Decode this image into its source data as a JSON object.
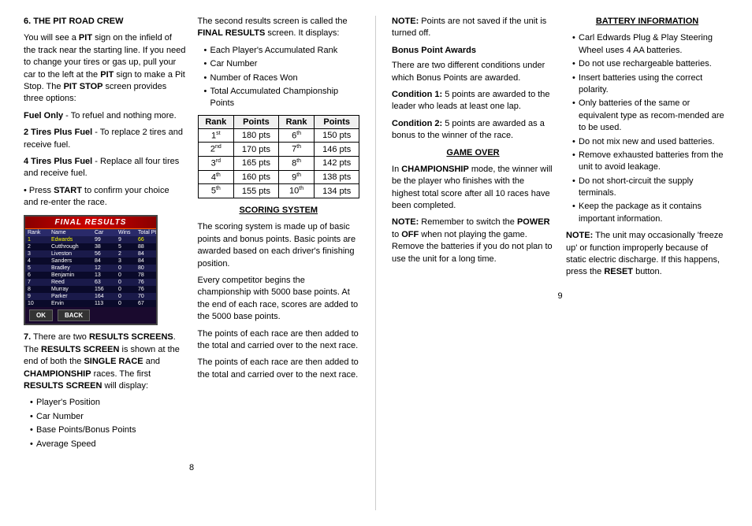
{
  "page_left": {
    "page_number": "8",
    "col1": {
      "section6_heading": "6. THE PIT ROAD CREW",
      "section6_para1": "You will see a ",
      "section6_pit": "PIT",
      "section6_para1b": " sign on the infield of the track near the starting line. If you need to change your tires or gas up, pull your car to the left at the ",
      "section6_pit2": "PIT",
      "section6_para1c": " sign to make a Pit Stop. The ",
      "section6_pitstop": "PIT STOP",
      "section6_para1d": " screen provides three options:",
      "fuel_only_label": "Fuel Only",
      "fuel_only_text": " - To refuel and nothing more.",
      "tires2_label": "2 Tires Plus Fuel",
      "tires2_text": " - To replace 2 tires and receive fuel.",
      "tires4_label": "4 Tires Plus Fuel",
      "tires4_text": " - Replace all four tires and receive fuel.",
      "press_start": "START",
      "press_text": " to confirm your choice and re-enter the race.",
      "final_results_title": "FINAL RESULTS",
      "fr_table_headers": [
        "Rank",
        "Name",
        "Car",
        "Wins",
        "Total Pts"
      ],
      "fr_rows": [
        [
          "1",
          "Edwards",
          "99",
          "9",
          "66"
        ],
        [
          "2",
          "Cutthrough",
          "38",
          "5",
          "88"
        ],
        [
          "3",
          "Liveston",
          "56",
          "2",
          "84"
        ],
        [
          "4",
          "Sanders",
          "84",
          "3",
          "84"
        ],
        [
          "5",
          "Bradley",
          "12",
          "0",
          "80"
        ],
        [
          "6",
          "Benjamin",
          "13",
          "0",
          "78"
        ],
        [
          "7",
          "Reed",
          "63",
          "0",
          "76"
        ],
        [
          "8",
          "Murray",
          "156",
          "0",
          "76"
        ],
        [
          "9",
          "Parker",
          "164",
          "0",
          "70"
        ],
        [
          "10",
          "Ervin",
          "113",
          "0",
          "67"
        ]
      ],
      "fr_ok": "OK",
      "fr_back": "BACK",
      "section7_text1": "7. There are two ",
      "section7_results": "RESULTS",
      "section7_text2": " SCREENS. The ",
      "section7_results2": "RESULTS",
      "section7_text3": " SCREEN is shown at the end of both the ",
      "section7_single": "SINGLE RACE",
      "section7_text4": " and ",
      "section7_champ": "CHAMPIONSHIP",
      "section7_text5": " races. The first ",
      "section7_results3": "RESULTS SCREEN",
      "section7_text6": " will display:",
      "results1_bullets": [
        "Player's Position",
        "Car Number",
        "Base Points/Bonus Points",
        "Average Speed"
      ]
    },
    "col2": {
      "para1": "The second results screen is called the ",
      "final_results_bold": "FINAL RESULTS",
      "para1b": " screen. It displays:",
      "bullets": [
        "Each Player's Accumulated Rank",
        "Car Number",
        "Number of Races Won",
        "Total Accumulated Championship Points"
      ],
      "table_headers": [
        "Rank",
        "Points",
        "Rank",
        "Points"
      ],
      "table_rows": [
        [
          "1st",
          "180 pts",
          "6th",
          "150 pts"
        ],
        [
          "2nd",
          "170 pts",
          "7th",
          "146 pts"
        ],
        [
          "3rd",
          "165 pts",
          "8th",
          "142 pts"
        ],
        [
          "4th",
          "160 pts",
          "9th",
          "138 pts"
        ],
        [
          "5th",
          "155 pts",
          "10th",
          "134 pts"
        ]
      ],
      "scoring_heading": "SCORING SYSTEM",
      "scoring_para1": "The scoring system is made up of basic points and bonus points. Basic points are awarded based on each driver's finishing position.",
      "scoring_para2": "Every competitor begins the championship with 5000 base points.  At the end of each race, scores are added to the 5000 base points.",
      "scoring_para3": "The points of each race are then added to the total and carried over to the next race.",
      "scoring_para4": "The points of each race are then added to the total and carried over to the next race."
    }
  },
  "page_right": {
    "page_number": "9",
    "col1": {
      "note1_bold": "NOTE:",
      "note1_text": " Points are not saved if the unit is turned off.",
      "bonus_heading": "Bonus Point Awards",
      "bonus_para": "There are two different conditions under which Bonus Points are awarded.",
      "cond1_bold": "Condition 1:",
      "cond1_text": " 5 points are awarded to the leader who leads at least one lap.",
      "cond2_bold": "Condition 2:",
      "cond2_text": " 5 points are awarded as a bonus to the winner of the race.",
      "gameover_heading": "GAME OVER",
      "gameover_bold": "CHAMPIONSHIP",
      "gameover_para": " mode, the winner will be the player who finishes with the highest total score after all 10 races have been completed.",
      "note2_bold": "NOTE:",
      "note2_power": "POWER",
      "note2_off": "OFF",
      "note2_text": " Remember to switch the ",
      "note2_text2": " to ",
      "note2_text3": " when not playing the game. Remove the batteries if you do not plan to use the unit for a long time."
    },
    "col2": {
      "battery_heading": "BATTERY INFORMATION",
      "battery_bullets": [
        "Carl Edwards Plug & Play Steering Wheel uses 4 AA batteries.",
        "Do not use rechargeable batteries.",
        "Insert batteries using the correct polarity.",
        "Only batteries of the same or equivalent type as recom-mended are to be used.",
        "Do not mix new and used batteries.",
        "Remove exhausted batteries from the unit to avoid leakage.",
        "Do not short-circuit the supply terminals.",
        "Keep the package as it contains important information."
      ],
      "note3_bold": "NOTE:",
      "note3_text": " The unit may occasionally 'freeze up' or function improperly because of static electric discharge. If this happens, press the ",
      "note3_reset": "RESET",
      "note3_text2": " button."
    }
  }
}
